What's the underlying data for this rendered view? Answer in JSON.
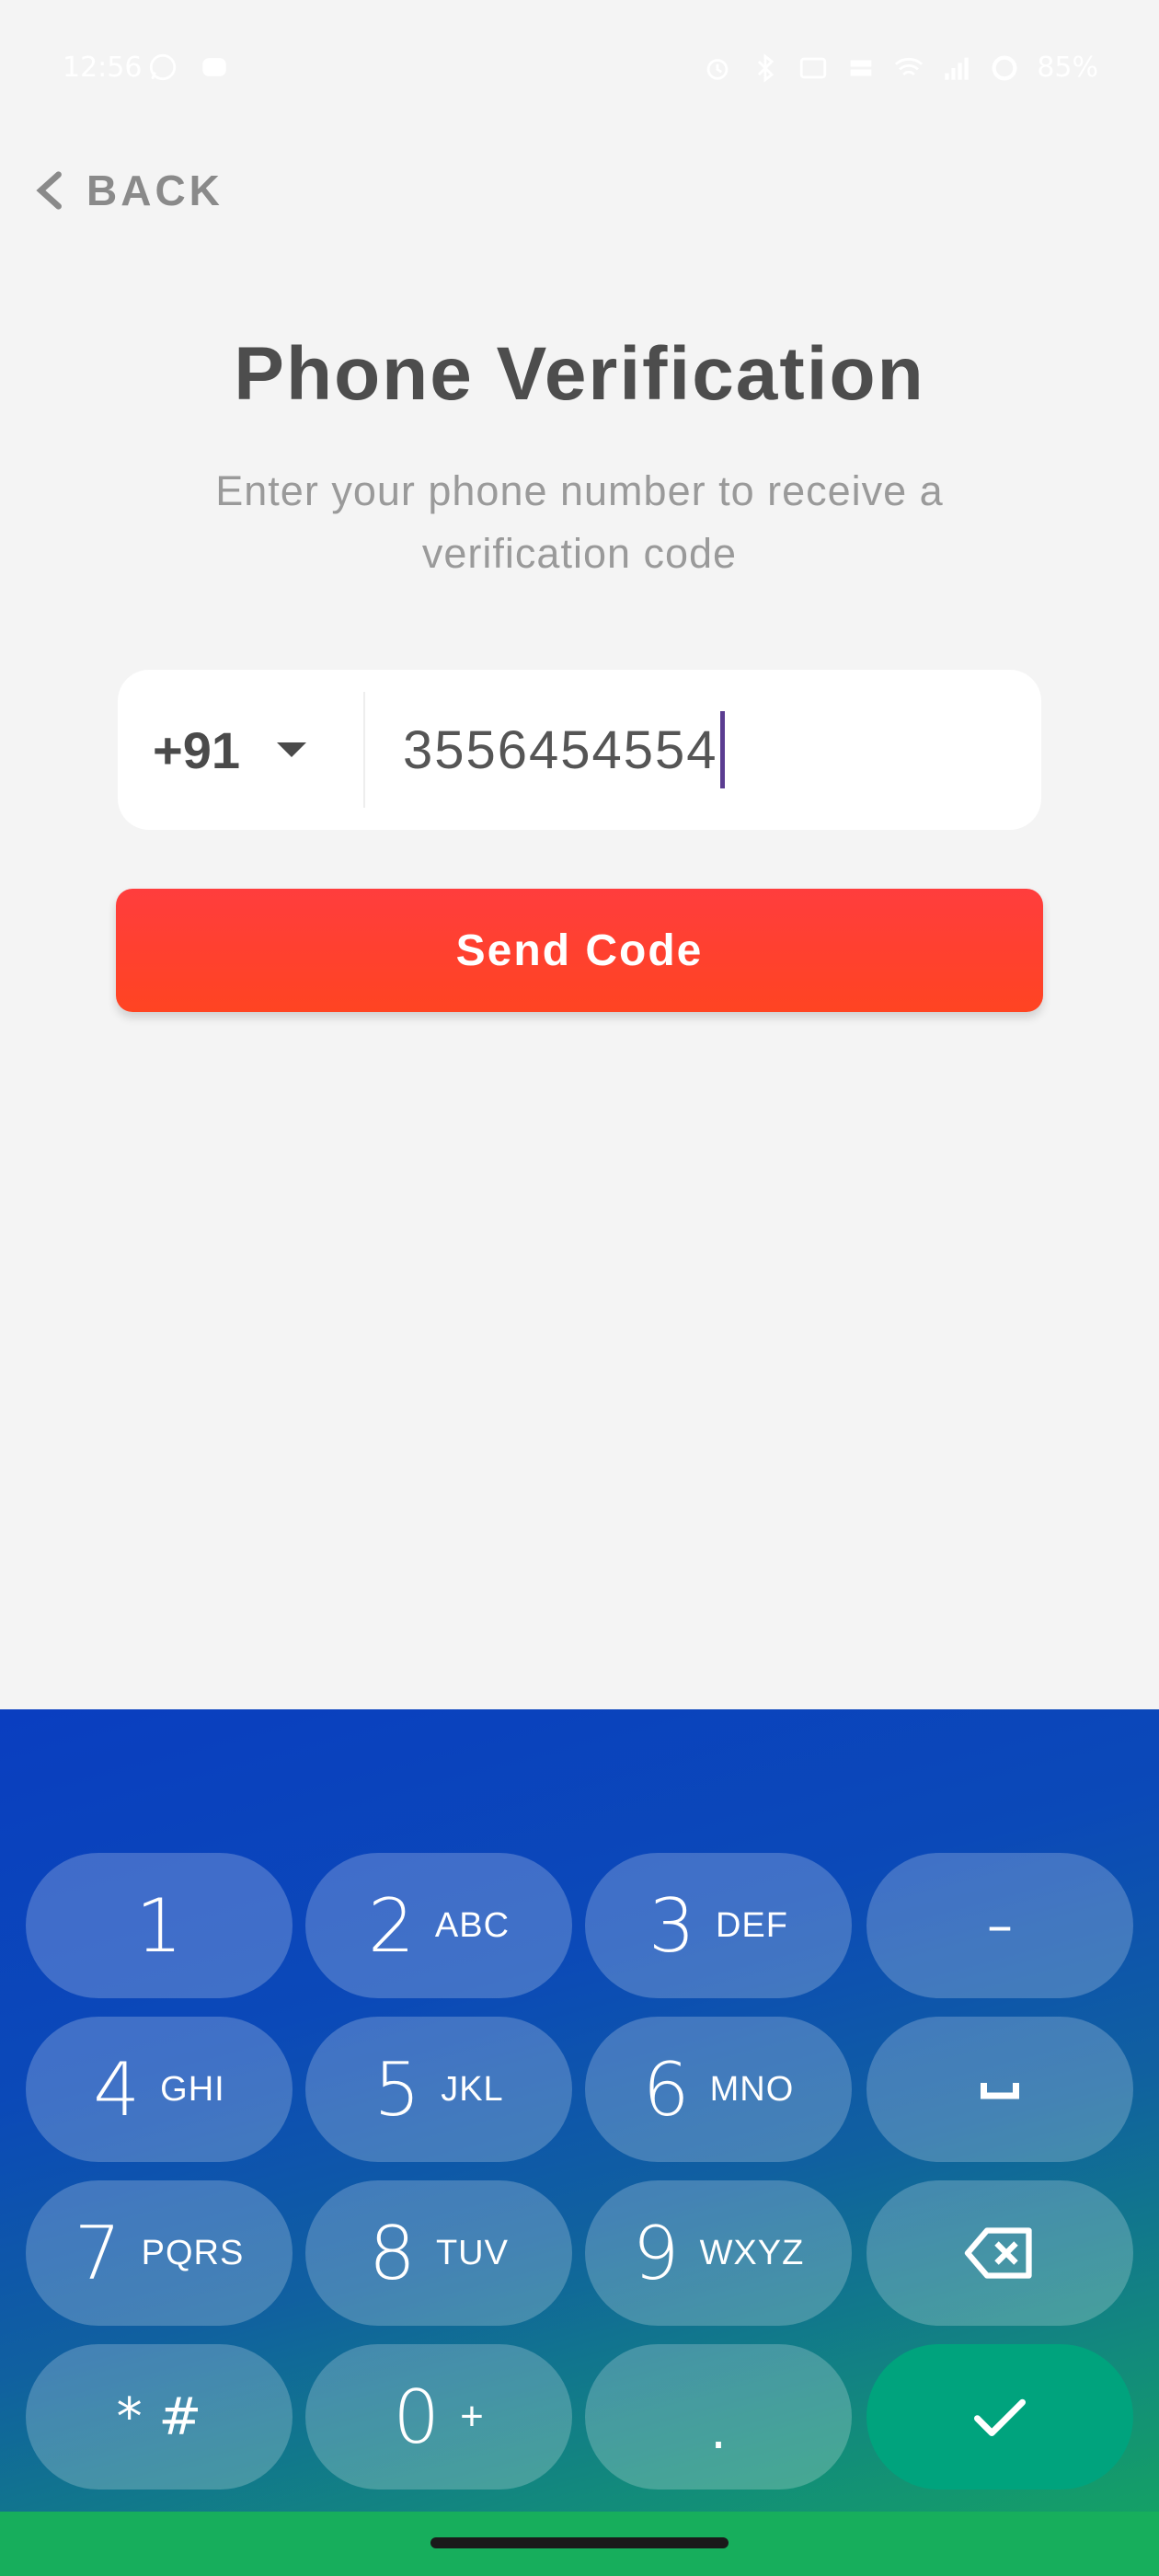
{
  "status_bar": {
    "time": "12:56",
    "battery": "85%"
  },
  "back": {
    "label": "BACK"
  },
  "title": "Phone Verification",
  "subtitle": "Enter your phone number to receive a verification code",
  "phone": {
    "country_code": "+91",
    "number": "3556454554"
  },
  "send_button": {
    "label": "Send Code"
  },
  "keypad": {
    "k1": {
      "digit": "1",
      "letters": ""
    },
    "k2": {
      "digit": "2",
      "letters": "ABC"
    },
    "k3": {
      "digit": "3",
      "letters": "DEF"
    },
    "k4": {
      "digit": "4",
      "letters": "GHI"
    },
    "k5": {
      "digit": "5",
      "letters": "JKL"
    },
    "k6": {
      "digit": "6",
      "letters": "MNO"
    },
    "k7": {
      "digit": "7",
      "letters": "PQRS"
    },
    "k8": {
      "digit": "8",
      "letters": "TUV"
    },
    "k9": {
      "digit": "9",
      "letters": "WXYZ"
    },
    "k0": {
      "digit": "0",
      "letters": "+"
    },
    "star_hash": "* #",
    "minus": "–",
    "dot": ".",
    "space_icon": "space-icon",
    "backspace_icon": "backspace-icon",
    "done_icon": "check-icon"
  },
  "colors": {
    "accent": "#ff3d3d",
    "keyboard_top": "#0a3ec0",
    "keyboard_bottom": "#14a066",
    "done_key": "#00a37d"
  }
}
